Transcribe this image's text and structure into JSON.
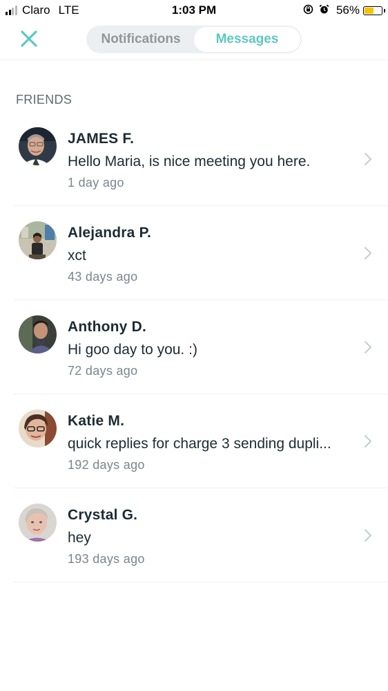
{
  "status_bar": {
    "carrier": "Claro",
    "network": "LTE",
    "time": "1:03 PM",
    "battery_percent_text": "56%",
    "battery_level": 0.56,
    "icons": [
      "signal-icon",
      "orientation-lock-icon",
      "alarm-icon",
      "battery-icon"
    ]
  },
  "header": {
    "close_icon": "close-icon",
    "tabs": [
      {
        "label": "Notifications",
        "active": false
      },
      {
        "label": "Messages",
        "active": true
      }
    ],
    "accent_color": "#5cc8c3"
  },
  "section": {
    "title": "FRIENDS"
  },
  "messages": [
    {
      "name": "JAMES F.",
      "message": "Hello Maria, is nice meeting you here.",
      "time": "1 day ago"
    },
    {
      "name": "Alejandra P.",
      "message": "xct",
      "time": "43 days ago"
    },
    {
      "name": "Anthony D.",
      "message": "Hi goo day to you. :)",
      "time": "72 days ago"
    },
    {
      "name": "Katie M.",
      "message": "quick replies for charge 3 sending dupli...",
      "time": "192 days ago"
    },
    {
      "name": "Crystal G.",
      "message": "hey",
      "time": "193 days ago"
    }
  ]
}
